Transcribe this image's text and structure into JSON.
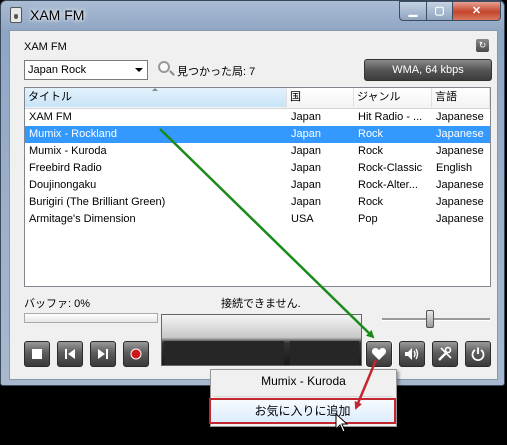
{
  "window": {
    "title": "XAM FM"
  },
  "station_name": "XAM FM",
  "filter": {
    "genre": "Japan Rock",
    "found_label": "見つかった局: 7"
  },
  "codec": "WMA, 64 kbps",
  "table": {
    "columns": [
      "タイトル",
      "国",
      "ジャンル",
      "言語"
    ],
    "rows": [
      [
        "XAM FM",
        "Japan",
        "Hit Radio - ...",
        "Japanese"
      ],
      [
        "Mumix - Rockland",
        "Japan",
        "Rock",
        "Japanese"
      ],
      [
        "Mumix - Kuroda",
        "Japan",
        "Rock",
        "Japanese"
      ],
      [
        "Freebird Radio",
        "Japan",
        "Rock-Classic",
        "English"
      ],
      [
        "Doujinongaku",
        "Japan",
        "Rock-Alter...",
        "Japanese"
      ],
      [
        "Burigiri (The Brilliant Green)",
        "Japan",
        "Rock",
        "Japanese"
      ],
      [
        "Armitage's Dimension",
        "USA",
        "Pop",
        "Japanese"
      ]
    ],
    "selected_index": 1
  },
  "status": {
    "buffer": "バッファ: 0%",
    "connection": "接続できません."
  },
  "volume_level": 0.48,
  "popup": {
    "station": "Mumix - Kuroda",
    "add_favorite": "お気に入りに追加"
  },
  "colors": {
    "selection": "#3399ff",
    "arrow_green": "#1a8a1a",
    "arrow_red": "#c1272d"
  },
  "icons": [
    "stop-icon",
    "previous-icon",
    "next-icon",
    "record-icon",
    "heart-icon",
    "speaker-icon",
    "tools-icon",
    "power-icon"
  ]
}
